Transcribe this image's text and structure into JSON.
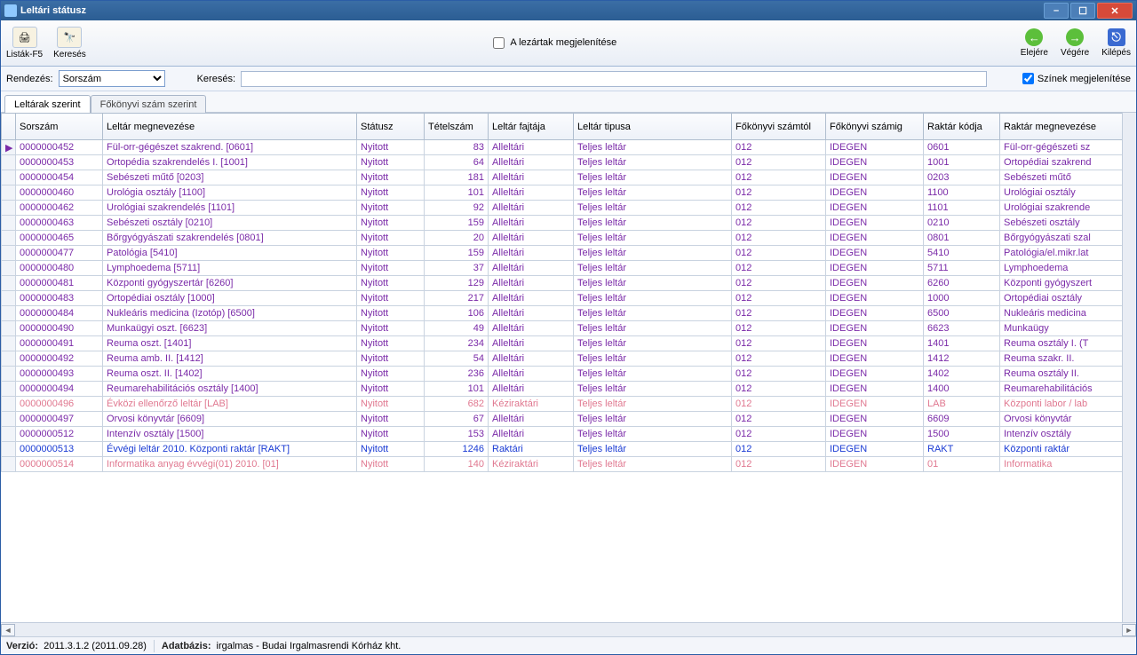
{
  "window": {
    "title": "Leltári státusz"
  },
  "toolbar": {
    "lists": "Listák-F5",
    "search": "Keresés",
    "closed_checkbox_label": "A lezártak megjelenítése",
    "nav_first": "Elejére",
    "nav_last": "Végére",
    "exit": "Kilépés"
  },
  "filter": {
    "sort_label": "Rendezés:",
    "sort_value": "Sorszám",
    "search_label": "Keresés:",
    "search_value": "",
    "colors_label": "Színek megjelenítése"
  },
  "tabs": {
    "t0": "Leltárak szerint",
    "t1": "Főkönyvi szám szerint"
  },
  "columns": {
    "c0": "Sorszám",
    "c1": "Leltár megnevezése",
    "c2": "Státusz",
    "c3": "Tételszám",
    "c4": "Leltár fajtája",
    "c5": "Leltár tipusa",
    "c6": "Főkönyvi számtól",
    "c7": "Főkönyvi számig",
    "c8": "Raktár kódja",
    "c9": "Raktár megnevezése"
  },
  "rows": [
    {
      "cls": "c-purple",
      "c0": "0000000452",
      "c1": "Fül-orr-gégészet szakrend. [0601]",
      "c2": "Nyitott",
      "c3": "83",
      "c4": "Alleltári",
      "c5": "Teljes leltár",
      "c6": "012",
      "c7": "IDEGEN",
      "c8": "0601",
      "c9": "Fül-orr-gégészeti sz"
    },
    {
      "cls": "c-purple",
      "c0": "0000000453",
      "c1": "Ortopédia szakrendelés I. [1001]",
      "c2": "Nyitott",
      "c3": "64",
      "c4": "Alleltári",
      "c5": "Teljes leltár",
      "c6": "012",
      "c7": "IDEGEN",
      "c8": "1001",
      "c9": "Ortopédiai szakrend"
    },
    {
      "cls": "c-purple",
      "c0": "0000000454",
      "c1": "Sebészeti műtő [0203]",
      "c2": "Nyitott",
      "c3": "181",
      "c4": "Alleltári",
      "c5": "Teljes leltár",
      "c6": "012",
      "c7": "IDEGEN",
      "c8": "0203",
      "c9": "Sebészeti műtő"
    },
    {
      "cls": "c-purple",
      "c0": "0000000460",
      "c1": "Urológia osztály [1100]",
      "c2": "Nyitott",
      "c3": "101",
      "c4": "Alleltári",
      "c5": "Teljes leltár",
      "c6": "012",
      "c7": "IDEGEN",
      "c8": "1100",
      "c9": "Urológiai osztály"
    },
    {
      "cls": "c-purple",
      "c0": "0000000462",
      "c1": "Urológiai szakrendelés [1101]",
      "c2": "Nyitott",
      "c3": "92",
      "c4": "Alleltári",
      "c5": "Teljes leltár",
      "c6": "012",
      "c7": "IDEGEN",
      "c8": "1101",
      "c9": "Urológiai szakrende"
    },
    {
      "cls": "c-purple",
      "c0": "0000000463",
      "c1": "Sebészeti osztály [0210]",
      "c2": "Nyitott",
      "c3": "159",
      "c4": "Alleltári",
      "c5": "Teljes leltár",
      "c6": "012",
      "c7": "IDEGEN",
      "c8": "0210",
      "c9": "Sebészeti osztály"
    },
    {
      "cls": "c-purple",
      "c0": "0000000465",
      "c1": "Bőrgyógyászati szakrendelés [0801]",
      "c2": "Nyitott",
      "c3": "20",
      "c4": "Alleltári",
      "c5": "Teljes leltár",
      "c6": "012",
      "c7": "IDEGEN",
      "c8": "0801",
      "c9": "Bőrgyógyászati szal"
    },
    {
      "cls": "c-purple",
      "c0": "0000000477",
      "c1": "Patológia  [5410]",
      "c2": "Nyitott",
      "c3": "159",
      "c4": "Alleltári",
      "c5": "Teljes leltár",
      "c6": "012",
      "c7": "IDEGEN",
      "c8": "5410",
      "c9": "Patológia/el.mikr.lat"
    },
    {
      "cls": "c-purple",
      "c0": "0000000480",
      "c1": "Lymphoedema [5711]",
      "c2": "Nyitott",
      "c3": "37",
      "c4": "Alleltári",
      "c5": "Teljes leltár",
      "c6": "012",
      "c7": "IDEGEN",
      "c8": "5711",
      "c9": "Lymphoedema"
    },
    {
      "cls": "c-purple",
      "c0": "0000000481",
      "c1": "Központi gyógyszertár [6260]",
      "c2": "Nyitott",
      "c3": "129",
      "c4": "Alleltári",
      "c5": "Teljes leltár",
      "c6": "012",
      "c7": "IDEGEN",
      "c8": "6260",
      "c9": "Központi gyógyszert"
    },
    {
      "cls": "c-purple",
      "c0": "0000000483",
      "c1": "Ortopédiai osztály [1000]",
      "c2": "Nyitott",
      "c3": "217",
      "c4": "Alleltári",
      "c5": "Teljes leltár",
      "c6": "012",
      "c7": "IDEGEN",
      "c8": "1000",
      "c9": "Ortopédiai osztály"
    },
    {
      "cls": "c-purple",
      "c0": "0000000484",
      "c1": "Nukleáris medicina (Izotóp) [6500]",
      "c2": "Nyitott",
      "c3": "106",
      "c4": "Alleltári",
      "c5": "Teljes leltár",
      "c6": "012",
      "c7": "IDEGEN",
      "c8": "6500",
      "c9": "Nukleáris medicina"
    },
    {
      "cls": "c-purple",
      "c0": "0000000490",
      "c1": "Munkaügyi oszt. [6623]",
      "c2": "Nyitott",
      "c3": "49",
      "c4": "Alleltári",
      "c5": "Teljes leltár",
      "c6": "012",
      "c7": "IDEGEN",
      "c8": "6623",
      "c9": "Munkaügy"
    },
    {
      "cls": "c-purple",
      "c0": "0000000491",
      "c1": "Reuma oszt. [1401]",
      "c2": "Nyitott",
      "c3": "234",
      "c4": "Alleltári",
      "c5": "Teljes leltár",
      "c6": "012",
      "c7": "IDEGEN",
      "c8": "1401",
      "c9": "Reuma osztály I. (T"
    },
    {
      "cls": "c-purple",
      "c0": "0000000492",
      "c1": "Reuma amb. II. [1412]",
      "c2": "Nyitott",
      "c3": "54",
      "c4": "Alleltári",
      "c5": "Teljes leltár",
      "c6": "012",
      "c7": "IDEGEN",
      "c8": "1412",
      "c9": "Reuma szakr. II."
    },
    {
      "cls": "c-purple",
      "c0": "0000000493",
      "c1": "Reuma oszt.  II. [1402]",
      "c2": "Nyitott",
      "c3": "236",
      "c4": "Alleltári",
      "c5": "Teljes leltár",
      "c6": "012",
      "c7": "IDEGEN",
      "c8": "1402",
      "c9": "Reuma osztály II."
    },
    {
      "cls": "c-purple",
      "c0": "0000000494",
      "c1": "Reumarehabilitációs osztály [1400]",
      "c2": "Nyitott",
      "c3": "101",
      "c4": "Alleltári",
      "c5": "Teljes leltár",
      "c6": "012",
      "c7": "IDEGEN",
      "c8": "1400",
      "c9": "Reumarehabilitációs"
    },
    {
      "cls": "c-pink",
      "c0": "0000000496",
      "c1": "Évközi ellenőrző leltár [LAB]",
      "c2": "Nyitott",
      "c3": "682",
      "c4": "Kéziraktári",
      "c5": "Teljes leltár",
      "c6": "012",
      "c7": "IDEGEN",
      "c8": "LAB",
      "c9": "Központi labor / lab"
    },
    {
      "cls": "c-purple",
      "c0": "0000000497",
      "c1": "Orvosi könyvtár [6609]",
      "c2": "Nyitott",
      "c3": "67",
      "c4": "Alleltári",
      "c5": "Teljes leltár",
      "c6": "012",
      "c7": "IDEGEN",
      "c8": "6609",
      "c9": "Orvosi könyvtár"
    },
    {
      "cls": "c-purple",
      "c0": "0000000512",
      "c1": "Intenzív osztály [1500]",
      "c2": "Nyitott",
      "c3": "153",
      "c4": "Alleltári",
      "c5": "Teljes leltár",
      "c6": "012",
      "c7": "IDEGEN",
      "c8": "1500",
      "c9": "Intenzív osztály"
    },
    {
      "cls": "c-blue",
      "c0": "0000000513",
      "c1": "Évvégi leltár 2010. Központi raktár  [RAKT]",
      "c2": "Nyitott",
      "c3": "1246",
      "c4": "Raktári",
      "c5": "Teljes leltár",
      "c6": "012",
      "c7": "IDEGEN",
      "c8": "RAKT",
      "c9": "Központi raktár"
    },
    {
      "cls": "c-pink",
      "c0": "0000000514",
      "c1": "Informatika anyag évvégi(01) 2010. [01]",
      "c2": "Nyitott",
      "c3": "140",
      "c4": "Kéziraktári",
      "c5": "Teljes leltár",
      "c6": "012",
      "c7": "IDEGEN",
      "c8": "01",
      "c9": "Informatika"
    }
  ],
  "status": {
    "version_label": "Verzió:",
    "version_value": "2011.3.1.2  (2011.09.28)",
    "db_label": "Adatbázis:",
    "db_value": "irgalmas - Budai Irgalmasrendi Kórház kht."
  }
}
